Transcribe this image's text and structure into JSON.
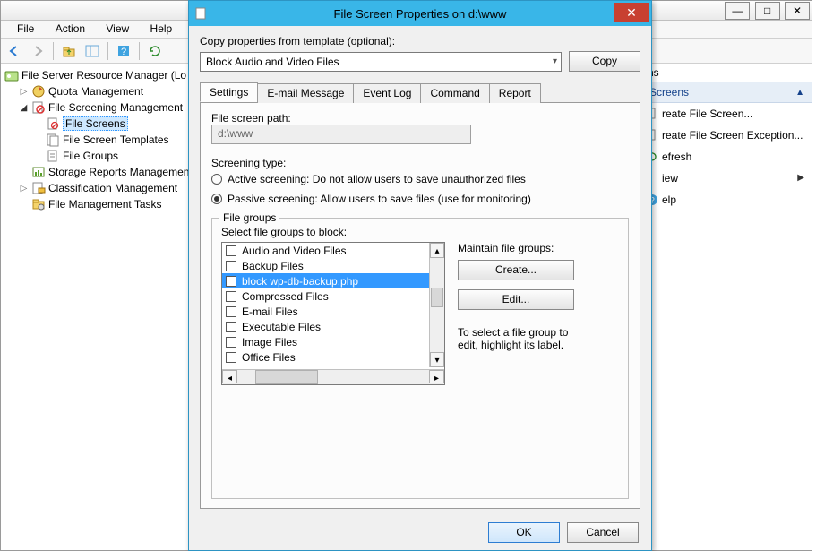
{
  "main_window": {
    "min_icon": "—",
    "max_icon": "□",
    "close_icon": "✕"
  },
  "menubar": {
    "file": "File",
    "action": "Action",
    "view": "View",
    "help": "Help"
  },
  "tree": {
    "root": "File Server Resource Manager (Lo",
    "quota": "Quota Management",
    "fsm": "File Screening Management",
    "file_screens": "File Screens",
    "templates": "File Screen Templates",
    "groups": "File Groups",
    "storage": "Storage Reports Managemen",
    "classif": "Classification Management",
    "tasks": "File Management Tasks"
  },
  "actions": {
    "header": "ns",
    "section": "Screens",
    "items": [
      "reate File Screen...",
      "reate File Screen Exception...",
      "efresh",
      "iew",
      "elp"
    ]
  },
  "dialog": {
    "title": "File Screen Properties on d:\\www",
    "copy_label": "Copy properties from template (optional):",
    "template_selected": "Block Audio and Video Files",
    "copy_btn": "Copy",
    "tabs": [
      "Settings",
      "E-mail Message",
      "Event Log",
      "Command",
      "Report"
    ],
    "path_label": "File screen path:",
    "path_value": "d:\\www",
    "scrtype_label": "Screening type:",
    "radio_active": "Active screening: Do not allow users to save unauthorized files",
    "radio_passive": "Passive screening: Allow users to save files (use for monitoring)",
    "groupbox_title": "File groups",
    "select_label": "Select file groups to block:",
    "maintain_label": "Maintain file groups:",
    "create_btn": "Create...",
    "edit_btn": "Edit...",
    "hint1": "To select a file group to",
    "hint2": "edit, highlight its label.",
    "ok": "OK",
    "cancel": "Cancel",
    "file_groups": [
      {
        "label": "Audio and Video Files",
        "checked": false
      },
      {
        "label": "Backup Files",
        "checked": false
      },
      {
        "label": "block wp-db-backup.php",
        "checked": true,
        "selected": true
      },
      {
        "label": "Compressed Files",
        "checked": false
      },
      {
        "label": "E-mail Files",
        "checked": false
      },
      {
        "label": "Executable Files",
        "checked": false
      },
      {
        "label": "Image Files",
        "checked": false
      },
      {
        "label": "Office Files",
        "checked": false
      }
    ]
  }
}
